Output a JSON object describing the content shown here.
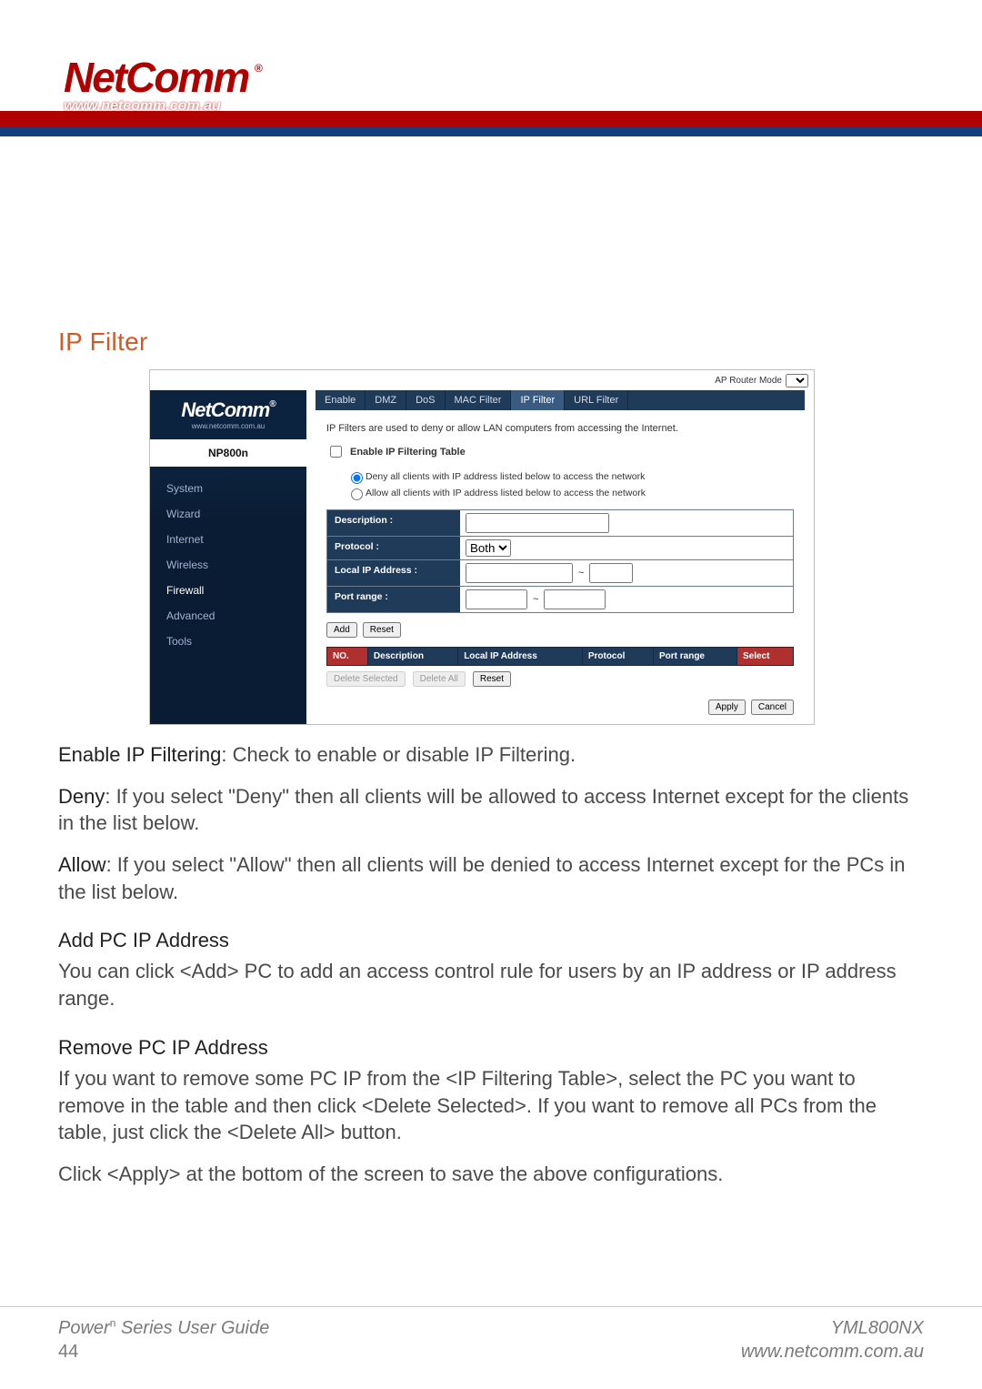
{
  "banner": {
    "brand": "NetComm",
    "reg_mark": "®",
    "url": "www.netcomm.com.au"
  },
  "page": {
    "section_title": "IP Filter"
  },
  "router": {
    "top_mode_label": "AP Router Mode",
    "side_brand": "NetComm",
    "side_reg": "®",
    "side_url": "www.netcomm.com.au",
    "model": "NP800n",
    "nav": [
      {
        "label": "System",
        "active": false
      },
      {
        "label": "Wizard",
        "active": false
      },
      {
        "label": "Internet",
        "active": false
      },
      {
        "label": "Wireless",
        "active": false
      },
      {
        "label": "Firewall",
        "active": true
      },
      {
        "label": "Advanced",
        "active": false
      },
      {
        "label": "Tools",
        "active": false
      }
    ],
    "tabs": [
      {
        "label": "Enable",
        "active": false
      },
      {
        "label": "DMZ",
        "active": false
      },
      {
        "label": "DoS",
        "active": false
      },
      {
        "label": "MAC Filter",
        "active": false
      },
      {
        "label": "IP Filter",
        "active": true
      },
      {
        "label": "URL Filter",
        "active": false
      }
    ],
    "intro_text": "IP Filters are used to deny or allow LAN computers from accessing the Internet.",
    "enable_checkbox_label": "Enable IP Filtering Table",
    "mode_radio": {
      "deny": "Deny all clients with IP address listed below to access the network",
      "allow": "Allow all clients with IP address listed below to access the network",
      "selected": "deny"
    },
    "form": {
      "description_label": "Description :",
      "protocol_label": "Protocol :",
      "protocol_value": "Both",
      "local_ip_label": "Local IP Address :",
      "local_ip_sep": "~",
      "port_range_label": "Port range :",
      "port_range_sep": "~"
    },
    "buttons": {
      "add": "Add",
      "reset": "Reset",
      "delete_selected": "Delete Selected",
      "delete_all": "Delete All",
      "reset2": "Reset",
      "apply": "Apply",
      "cancel": "Cancel"
    },
    "table_headers": {
      "no": "NO.",
      "description": "Description",
      "local_ip": "Local IP Address",
      "protocol": "Protocol",
      "port_range": "Port range",
      "select": "Select"
    }
  },
  "explain": {
    "enable_lead": "Enable IP Filtering",
    "enable_rest": ": Check to enable or disable IP Filtering.",
    "deny_lead": "Deny",
    "deny_rest": ": If you select \"Deny\" then all clients will be allowed to access Internet except for the clients in the list below.",
    "allow_lead": "Allow",
    "allow_rest": ": If you select \"Allow\" then all clients will be denied to access Internet except for the PCs in the list below.",
    "add_head": "Add PC IP Address",
    "add_body": "You can click <Add> PC to add an access control rule for users by an IP address or IP address range.",
    "remove_head": "Remove PC IP Address",
    "remove_body1": "If you want to remove some PC IP from the <IP Filtering Table>, select the PC you want to remove in the table and then click <Delete Selected>. If you want to remove all PCs from the table, just click the <Delete All> button.",
    "remove_body2": "Click <Apply> at the bottom of the screen to save the above configurations."
  },
  "footer": {
    "guide_line1_a": "Power",
    "guide_line1_sup": "n",
    "guide_line1_b": " Series User Guide",
    "page_number": "44",
    "doc_code": "YML800NX",
    "url": "www.netcomm.com.au"
  }
}
